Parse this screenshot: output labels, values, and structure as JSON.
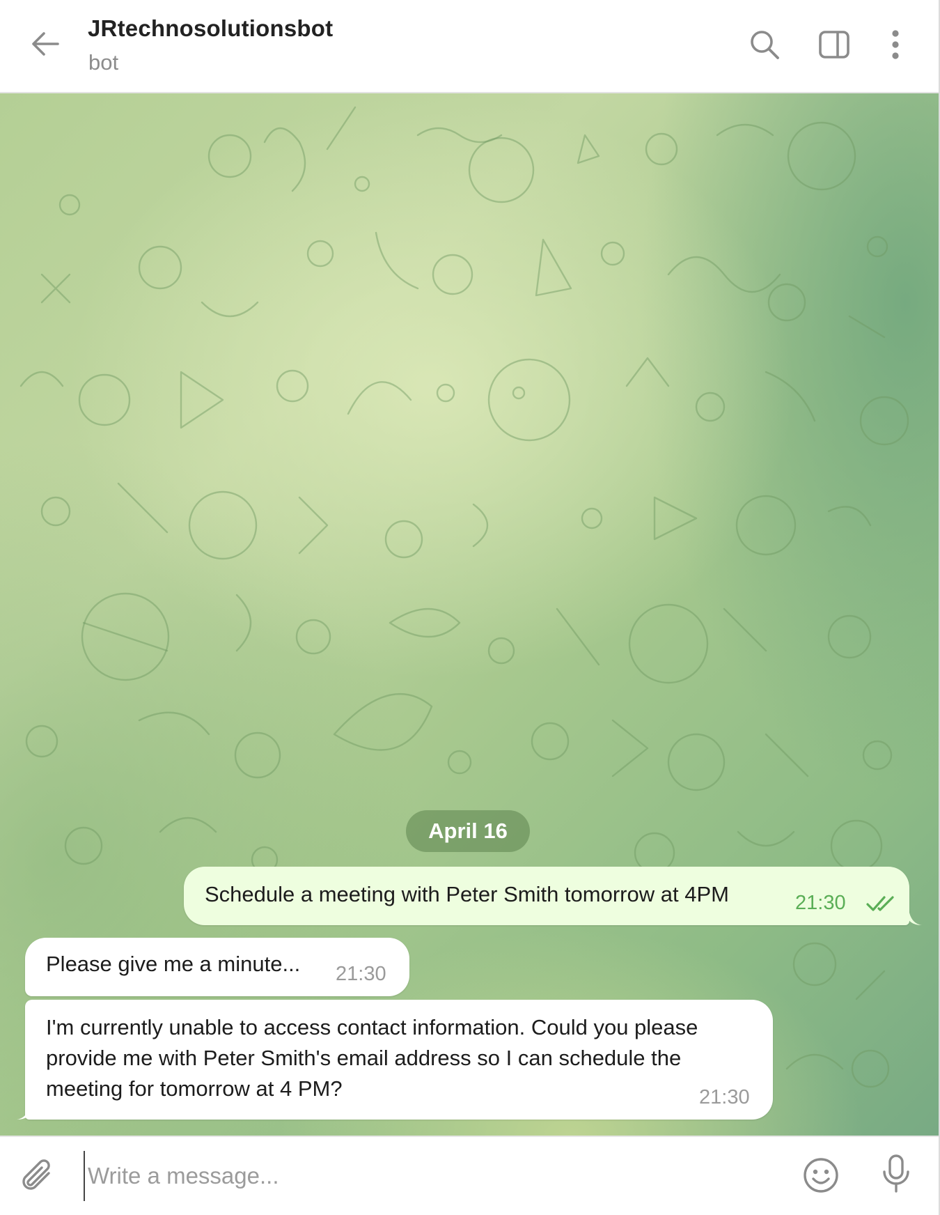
{
  "header": {
    "title": "JRtechnosolutionsbot",
    "subtitle": "bot",
    "back_icon": "arrow-left-icon",
    "search_icon": "search-icon",
    "panel_icon": "sidebar-toggle-icon",
    "menu_icon": "more-vertical-icon"
  },
  "chat": {
    "date_label": "April 16",
    "messages": [
      {
        "direction": "outgoing",
        "text": "Schedule a meeting with Peter Smith tomorrow at 4PM",
        "time": "21:30",
        "status": "read"
      },
      {
        "direction": "incoming",
        "text": "Please give me a minute...",
        "time": "21:30"
      },
      {
        "direction": "incoming",
        "text": "I'm currently unable to access contact information. Could you please provide me with Peter Smith's email address so I can schedule the meeting for tomorrow at 4 PM?",
        "time": "21:30"
      }
    ]
  },
  "composer": {
    "placeholder": "Write a message...",
    "value": "",
    "attach_icon": "paperclip-icon",
    "emoji_icon": "smiley-icon",
    "mic_icon": "microphone-icon"
  },
  "colors": {
    "outgoing_bubble": "#eefedf",
    "incoming_bubble": "#ffffff",
    "outgoing_time": "#5aae56",
    "date_pill": "#5c844e"
  }
}
